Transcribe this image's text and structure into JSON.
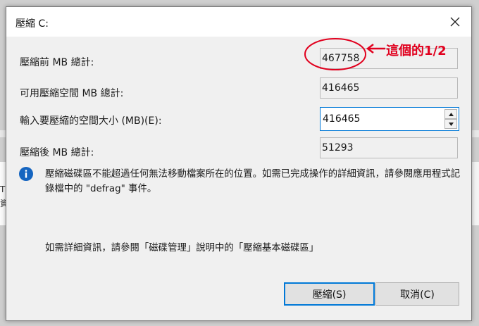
{
  "dialog": {
    "title": "壓縮 C:"
  },
  "fields": {
    "total_before": {
      "label": "壓縮前 MB 總計:",
      "value": "467758"
    },
    "available": {
      "label": "可用壓縮空間 MB 總計:",
      "value": "416465"
    },
    "amount": {
      "label": "輸入要壓縮的空間大小 (MB)(E):",
      "value": "416465"
    },
    "total_after": {
      "label": "壓縮後 MB 總計:",
      "value": "51293"
    }
  },
  "info": {
    "text": "壓縮磁碟區不能超過任何無法移動檔案所在的位置。如需已完成操作的詳細資訊，請參閱應用程式記錄檔中的 \"defrag\" 事件。",
    "more": "如需詳細資訊，請參閱「磁碟管理」說明中的「壓縮基本磁碟區」"
  },
  "buttons": {
    "shrink": "壓縮(S)",
    "cancel": "取消(C)"
  },
  "annotation": {
    "text": "這個的1/2",
    "color": "#e1001e"
  },
  "background": {
    "frag1": "TR",
    "frag2": "資"
  },
  "colors": {
    "accent": "#0078d7",
    "info_icon": "#1565c0"
  }
}
